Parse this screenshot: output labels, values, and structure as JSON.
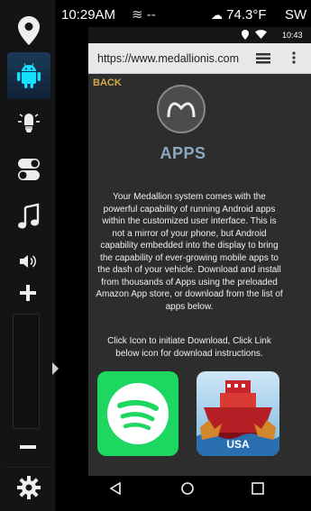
{
  "statusbar": {
    "time": "10:29AM",
    "wind": "≋ --",
    "weather": "74.3°F",
    "direction": "SW"
  },
  "android": {
    "clock": "10:43",
    "url": "https://www.medallionis.com",
    "back_label": "BACK",
    "apps_title": "APPS",
    "description": "Your Medallion system comes with the powerful capability of running Android apps within the customized user interface. This is not a mirror of your phone, but Android capability embedded into the display to bring the capability of ever-growing mobile apps to the dash of your vehicle. Download and install from thousands of Apps using the preloaded Amazon App store, or download from the list of apps below.",
    "instructions": "Click Icon to initiate Download, Click Link below icon for download instructions.",
    "app_usa_label": "USA"
  },
  "colors": {
    "accent_active": "#16e0ff",
    "back_text": "#d6a84a",
    "apps_title": "#8ea7c0",
    "spotify": "#1ed760"
  }
}
